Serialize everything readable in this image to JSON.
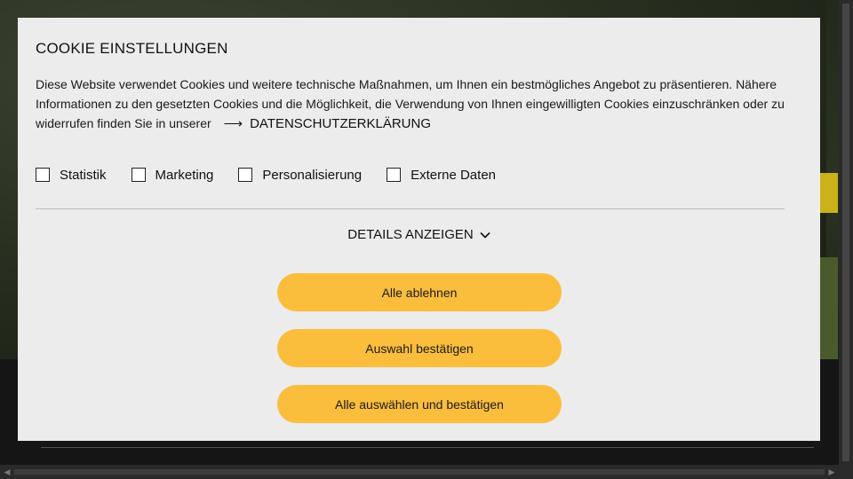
{
  "modal": {
    "title": "COOKIE EINSTELLUNGEN",
    "description": "Diese Website verwendet Cookies und weitere technische Maßnahmen, um Ihnen ein bestmögliches Angebot zu präsentieren. Nähere Informationen zu den gesetzten Cookies und die Möglichkeit, die Verwendung von Ihnen eingewilligten Cookies einzuschränken oder zu widerrufen finden Sie in unserer",
    "privacy_link_label": "DATENSCHUTZERKLÄRUNG",
    "privacy_link_icon": "arrow-right-icon",
    "options": [
      {
        "label": "Statistik",
        "checked": false
      },
      {
        "label": "Marketing",
        "checked": false
      },
      {
        "label": "Personalisierung",
        "checked": false
      },
      {
        "label": "Externe Daten",
        "checked": false
      }
    ],
    "details_label": "DETAILS ANZEIGEN",
    "details_icon": "chevron-down-icon",
    "buttons": {
      "reject_all": "Alle ablehnen",
      "confirm_selection": "Auswahl bestätigen",
      "accept_all": "Alle auswählen und bestätigen"
    }
  },
  "colors": {
    "modal_background": "#ececec",
    "button_background": "#fbbd3c",
    "overlay": "#1e1e1e"
  }
}
